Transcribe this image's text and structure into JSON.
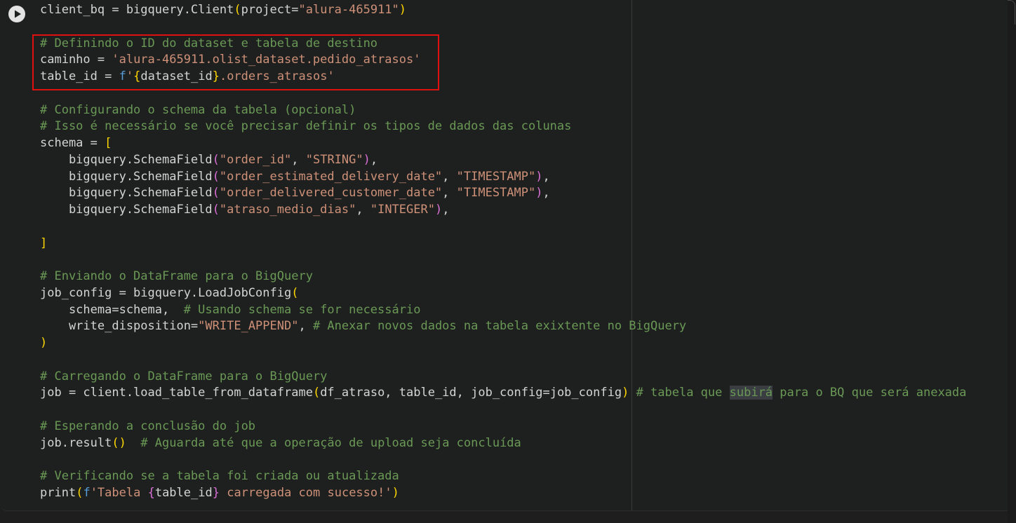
{
  "code_lines": [
    [
      {
        "t": "client_bq = bigquery.Client"
      },
      {
        "t": "(",
        "c": "b1"
      },
      {
        "t": "project="
      },
      {
        "t": "\"alura-465911\"",
        "c": "str"
      },
      {
        "t": ")",
        "c": "b1"
      }
    ],
    [],
    [
      {
        "t": "# Definindo o ID do dataset e tabela de destino",
        "c": "cmt"
      }
    ],
    [
      {
        "t": "caminho = "
      },
      {
        "t": "'alura-465911.olist_dataset.pedido_atrasos'",
        "c": "str"
      }
    ],
    [
      {
        "t": "table_id = "
      },
      {
        "t": "f",
        "c": "kw"
      },
      {
        "t": "'",
        "c": "str"
      },
      {
        "t": "{",
        "c": "b1"
      },
      {
        "t": "dataset_id"
      },
      {
        "t": "}",
        "c": "b1"
      },
      {
        "t": ".orders_atrasos'",
        "c": "str"
      }
    ],
    [],
    [
      {
        "t": "# Configurando o schema da tabela (opcional)",
        "c": "cmt"
      }
    ],
    [
      {
        "t": "# Isso é necessário se você precisar definir os tipos de dados das colunas",
        "c": "cmt"
      }
    ],
    [
      {
        "t": "schema = "
      },
      {
        "t": "[",
        "c": "b1"
      }
    ],
    [
      {
        "t": "    bigquery.SchemaField"
      },
      {
        "t": "(",
        "c": "b2"
      },
      {
        "t": "\"order_id\"",
        "c": "str"
      },
      {
        "t": ", "
      },
      {
        "t": "\"STRING\"",
        "c": "str"
      },
      {
        "t": ")",
        "c": "b2"
      },
      {
        "t": ","
      }
    ],
    [
      {
        "t": "    bigquery.SchemaField"
      },
      {
        "t": "(",
        "c": "b2"
      },
      {
        "t": "\"order_estimated_delivery_date\"",
        "c": "str"
      },
      {
        "t": ", "
      },
      {
        "t": "\"TIMESTAMP\"",
        "c": "str"
      },
      {
        "t": ")",
        "c": "b2"
      },
      {
        "t": ","
      }
    ],
    [
      {
        "t": "    bigquery.SchemaField"
      },
      {
        "t": "(",
        "c": "b2"
      },
      {
        "t": "\"order_delivered_customer_date\"",
        "c": "str"
      },
      {
        "t": ", "
      },
      {
        "t": "\"TIMESTAMP\"",
        "c": "str"
      },
      {
        "t": ")",
        "c": "b2"
      },
      {
        "t": ","
      }
    ],
    [
      {
        "t": "    bigquery.SchemaField"
      },
      {
        "t": "(",
        "c": "b2"
      },
      {
        "t": "\"atraso_medio_dias\"",
        "c": "str"
      },
      {
        "t": ", "
      },
      {
        "t": "\"INTEGER\"",
        "c": "str"
      },
      {
        "t": ")",
        "c": "b2"
      },
      {
        "t": ","
      }
    ],
    [],
    [
      {
        "t": "]",
        "c": "b1"
      }
    ],
    [],
    [
      {
        "t": "# Enviando o DataFrame para o BigQuery",
        "c": "cmt"
      }
    ],
    [
      {
        "t": "job_config = bigquery.LoadJobConfig"
      },
      {
        "t": "(",
        "c": "b1"
      }
    ],
    [
      {
        "t": "    schema=schema,  "
      },
      {
        "t": "# Usando schema se for necessário",
        "c": "cmt"
      }
    ],
    [
      {
        "t": "    write_disposition="
      },
      {
        "t": "\"WRITE_APPEND\"",
        "c": "str"
      },
      {
        "t": ", "
      },
      {
        "t": "# Anexar novos dados na tabela exixtente no BigQuery",
        "c": "cmt"
      }
    ],
    [
      {
        "t": ")",
        "c": "b1"
      }
    ],
    [],
    [
      {
        "t": "# Carregando o DataFrame para o BigQuery",
        "c": "cmt"
      }
    ],
    [
      {
        "t": "job = client.load_table_from_dataframe"
      },
      {
        "t": "(",
        "c": "b1"
      },
      {
        "t": "df_atraso, table_id, job_config=job_config"
      },
      {
        "t": ")",
        "c": "b1"
      },
      {
        "t": " "
      },
      {
        "t": "# tabela que ",
        "c": "cmt"
      },
      {
        "t": "subirá",
        "c": "cmt hl"
      },
      {
        "t": " para o BQ que será anexada",
        "c": "cmt"
      }
    ],
    [],
    [
      {
        "t": "# Esperando a conclusão do job",
        "c": "cmt"
      }
    ],
    [
      {
        "t": "job.result"
      },
      {
        "t": "()",
        "c": "b1"
      },
      {
        "t": "  "
      },
      {
        "t": "# Aguarda até que a operação de upload seja concluída",
        "c": "cmt"
      }
    ],
    [],
    [
      {
        "t": "# Verificando se a tabela foi criada ou atualizada",
        "c": "cmt"
      }
    ],
    [
      {
        "t": "print"
      },
      {
        "t": "(",
        "c": "b1"
      },
      {
        "t": "f",
        "c": "kw"
      },
      {
        "t": "'Tabela ",
        "c": "str"
      },
      {
        "t": "{",
        "c": "b2"
      },
      {
        "t": "table_id"
      },
      {
        "t": "}",
        "c": "b2"
      },
      {
        "t": " carregada com sucesso!'",
        "c": "str"
      },
      {
        "t": ")",
        "c": "b1"
      }
    ]
  ],
  "colors": {
    "background": "#1e1f1f",
    "comment": "#6a9955",
    "string": "#ce9178",
    "keyword": "#569cd6",
    "bracket_gold": "#ffd700",
    "bracket_purple": "#da70d6",
    "highlight_box": "#e01010"
  },
  "icons": {
    "run": "play-icon"
  }
}
